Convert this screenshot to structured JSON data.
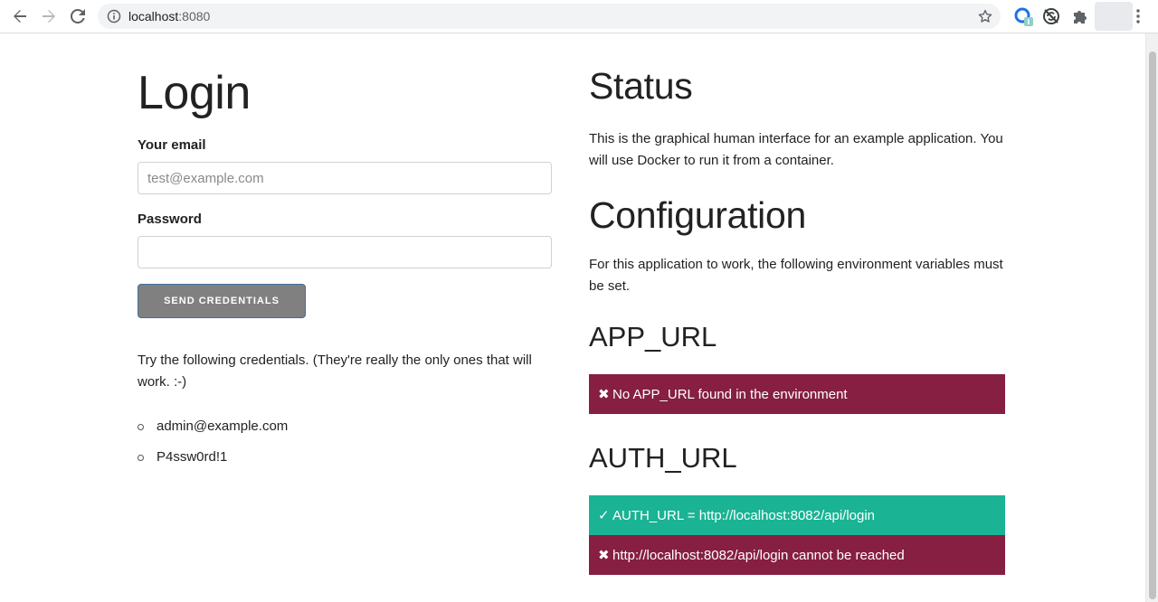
{
  "browser": {
    "url_host": "localhost",
    "url_port": ":8080"
  },
  "login": {
    "title": "Login",
    "email_label": "Your email",
    "email_placeholder": "test@example.com",
    "password_label": "Password",
    "password_value": "",
    "submit_label": "Send credentials",
    "hint": "Try the following credentials. (They're really the only ones that will work. :-)",
    "credentials": [
      "admin@example.com",
      "P4ssw0rd!1"
    ]
  },
  "status": {
    "title": "Status",
    "description": "This is the graphical human interface for an example application. You will use Docker to run it from a container."
  },
  "configuration": {
    "title": "Configuration",
    "description": "For this application to work, the following environment variables must be set.",
    "variables": [
      {
        "name": "APP_URL",
        "messages": [
          {
            "kind": "error",
            "glyph": "✖",
            "text": "No APP_URL found in the environment"
          }
        ]
      },
      {
        "name": "AUTH_URL",
        "messages": [
          {
            "kind": "ok",
            "glyph": "✓",
            "text": "AUTH_URL = http://localhost:8082/api/login"
          },
          {
            "kind": "error",
            "glyph": "✖",
            "text": "http://localhost:8082/api/login cannot be reached"
          }
        ]
      }
    ]
  },
  "colors": {
    "error": "#861f41",
    "ok": "#1ab394",
    "button": "#808080"
  }
}
